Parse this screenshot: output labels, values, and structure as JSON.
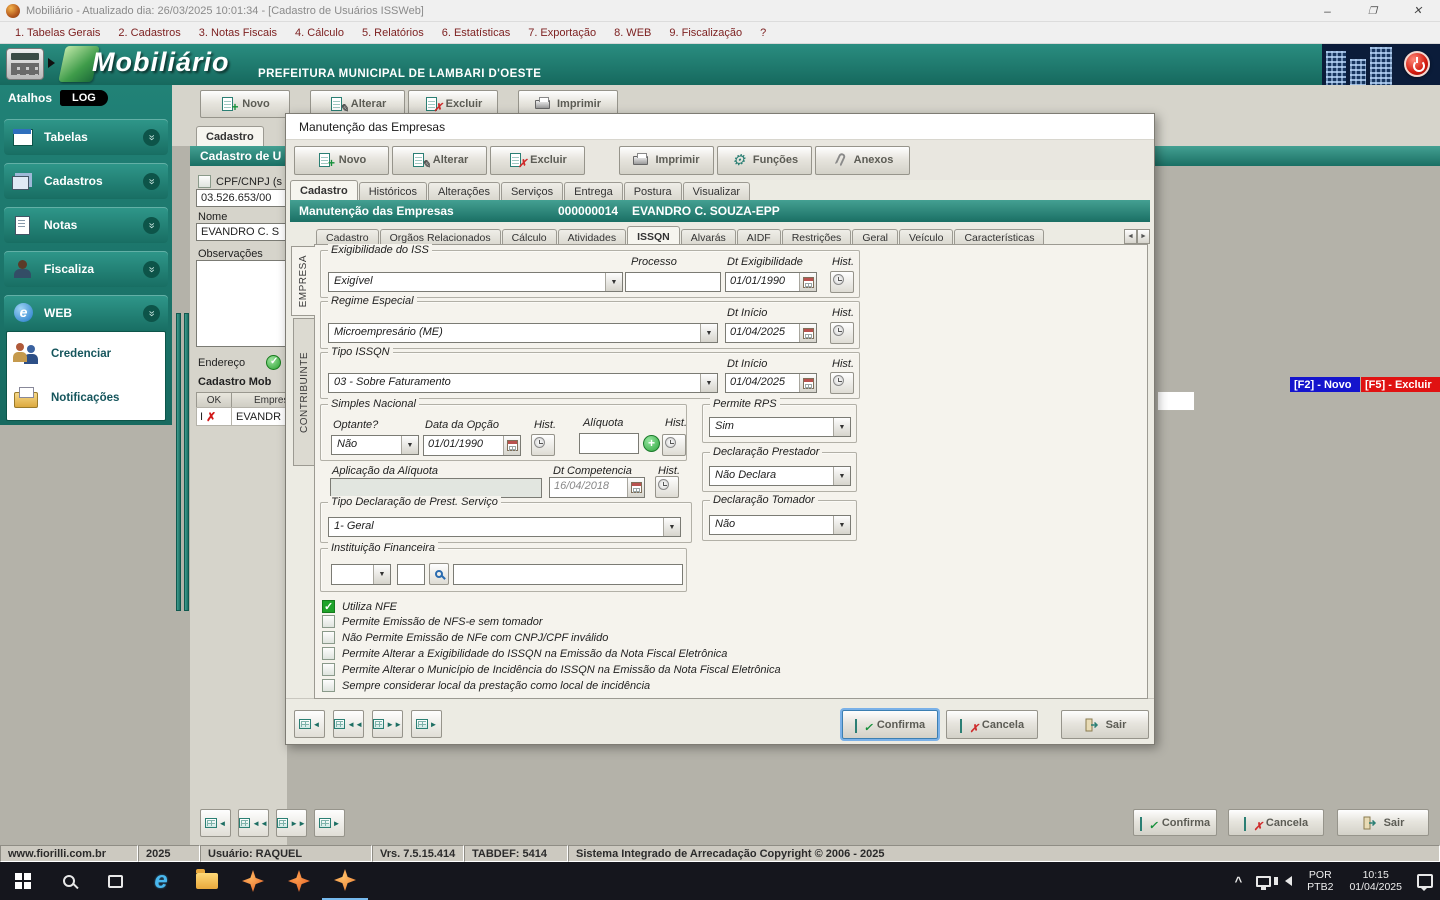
{
  "titlebar": {
    "title": "Mobiliário - Atualizado dia: 26/03/2025 10:01:34 - [Cadastro de Usuários ISSWeb]"
  },
  "menu": {
    "items": [
      "1. Tabelas Gerais",
      "2. Cadastros",
      "3. Notas Fiscais",
      "4. Cálculo",
      "5. Relatórios",
      "6. Estatísticas",
      "7. Exportação",
      "8. WEB",
      "9. Fiscalização",
      "?"
    ]
  },
  "banner": {
    "app": "Mobiliário",
    "municipality": "PREFEITURA MUNICIPAL DE LAMBARI D'OESTE"
  },
  "sidebar": {
    "atalhos": "Atalhos",
    "log": "LOG",
    "items": [
      "Tabelas",
      "Cadastros",
      "Notas",
      "Fiscaliza",
      "WEB"
    ],
    "web_items": [
      "Credenciar",
      "Notificações"
    ]
  },
  "bgwin": {
    "toolbar": [
      "Novo",
      "Alterar",
      "Excluir",
      "Imprimir"
    ],
    "tab": "Cadastro",
    "header": "Cadastro de U",
    "cpf_label": "CPF/CNPJ (s",
    "cpf_value": "03.526.653/00",
    "nome_label": "Nome",
    "nome_value": "EVANDRO C. S",
    "obs_label": "Observações",
    "endereco_label": "Endereço",
    "cad_mob_label": "Cadastro Mob",
    "grid": {
      "col_ok": "OK",
      "col_empresa": "Empresa",
      "row_flag": "I",
      "row_name": "EVANDR"
    },
    "hint_novo": "[F2] - Novo",
    "hint_excluir": "[F5] - Excluir",
    "confirma": "Confirma",
    "cancela": "Cancela",
    "sair": "Sair"
  },
  "dialog": {
    "title": "Manutenção das Empresas",
    "toolbar": [
      "Novo",
      "Alterar",
      "Excluir",
      "Imprimir",
      "Funções",
      "Anexos"
    ],
    "tabs": [
      "Cadastro",
      "Históricos",
      "Alterações",
      "Serviços",
      "Entrega",
      "Postura",
      "Visualizar"
    ],
    "header": {
      "title": "Manutenção das Empresas",
      "code": "000000014",
      "name": "EVANDRO C. SOUZA-EPP"
    },
    "side_tabs": [
      "EMPRESA",
      "CONTRIBUINTE"
    ],
    "inner_tabs": [
      "Cadastro",
      "Orgãos Relacionados",
      "Cálculo",
      "Atividades",
      "ISSQN",
      "Alvarás",
      "AIDF",
      "Restrições",
      "Geral",
      "Veículo",
      "Características"
    ],
    "groups": {
      "exig": {
        "title": "Exigibilidade do ISS",
        "value": "Exigível",
        "processo": "Processo",
        "dt_label": "Dt Exigibilidade",
        "dt": "01/01/1990",
        "hist": "Hist."
      },
      "regime": {
        "title": "Regime Especial",
        "value": "Microempresário (ME)",
        "dt_label": "Dt Início",
        "dt": "01/04/2025",
        "hist": "Hist."
      },
      "tipo": {
        "title": "Tipo ISSQN",
        "value": "03 - Sobre Faturamento",
        "dt_label": "Dt Início",
        "dt": "01/04/2025",
        "hist": "Hist."
      },
      "simples": {
        "title": "Simples Nacional",
        "optante_label": "Optante?",
        "optante": "Não",
        "data_label": "Data da Opção",
        "data": "01/01/1990",
        "hist": "Hist.",
        "aliquota_label": "Alíquota",
        "hist2": "Hist."
      },
      "rps": {
        "title": "Permite RPS",
        "value": "Sim"
      },
      "aplic": {
        "label": "Aplicação da Alíquota",
        "dt_label": "Dt Competencia",
        "dt": "16/04/2018",
        "hist": "Hist."
      },
      "decl_prest": {
        "title": "Declaração Prestador",
        "value": "Não Declara"
      },
      "tipo_decl": {
        "title": "Tipo Declaração de Prest. Serviço",
        "value": "1- Geral"
      },
      "decl_tom": {
        "title": "Declaração Tomador",
        "value": "Não"
      },
      "inst_fin": {
        "title": "Instituição Financeira"
      }
    },
    "checkboxes": [
      {
        "label": "Utiliza NFE",
        "checked": true
      },
      {
        "label": "Permite Emissão de NFS-e sem tomador",
        "checked": false
      },
      {
        "label": "Não Permite Emissão de NFe com CNPJ/CPF inválido",
        "checked": false
      },
      {
        "label": "Permite Alterar a Exigibilidade do ISSQN na Emissão da Nota Fiscal Eletrônica",
        "checked": false
      },
      {
        "label": "Permite Alterar o Município de Incidência do ISSQN na Emissão da Nota Fiscal Eletrônica",
        "checked": false
      },
      {
        "label": "Sempre considerar local da prestação como local de incidência",
        "checked": false
      }
    ],
    "confirma": "Confirma",
    "cancela": "Cancela",
    "sair": "Sair"
  },
  "statusbar": {
    "segments": [
      "www.fiorilli.com.br",
      "2025",
      "Usuário: RAQUEL",
      "Vrs. 7.5.15.414",
      "TABDEF: 5414",
      "Sistema Integrado de Arrecadação Copyright © 2006 - 2025"
    ]
  },
  "taskbar": {
    "lang": "POR",
    "keyboard": "PTB2",
    "time": "10:15",
    "date": "01/04/2025"
  }
}
